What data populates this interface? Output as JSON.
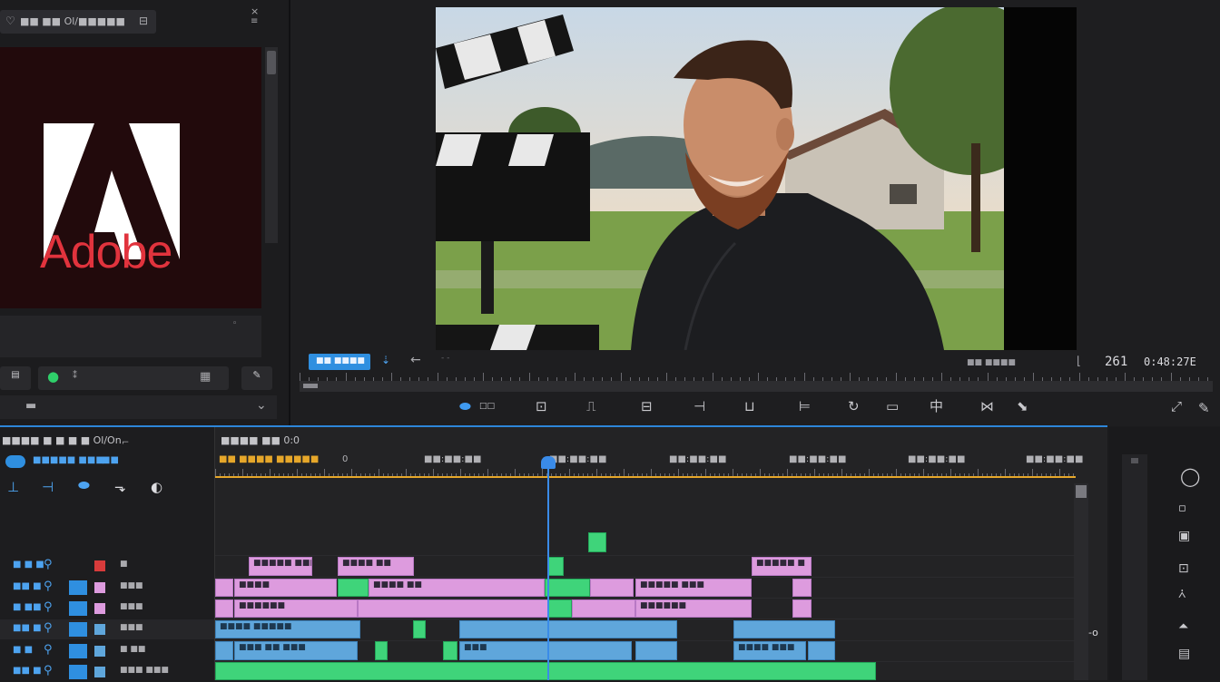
{
  "project": {
    "title": "■■ ■■ Ol/■■■■■"
  },
  "logo": {
    "text": "Adobe"
  },
  "program": {
    "timecode_label": "■■ ■■■■",
    "right_label": "■■ ■■■■",
    "frame_number": "261",
    "timecode": "0:48:27E"
  },
  "transport_icons": [
    "captions-icon",
    "safe-margins-icon",
    "mark-in-icon",
    "mark-out-icon",
    "add-marker-icon",
    "step-back-icon",
    "play-icon",
    "step-forward-icon",
    "go-to-out-icon",
    "insert-icon",
    "overwrite-icon",
    "export-frame-icon",
    "settings-icon"
  ],
  "timeline": {
    "header_title": "■■■■ ■ ■ ■ ■ Ol/On",
    "sequence_title": "■■■■ ■■ 0:0",
    "left_sub": "■■■■■ ■■■",
    "timecodes": [
      "■■ ■■■■ ■■■■■",
      "0",
      "■■:■■:■■",
      "■■:■■:■■",
      "■■:■■:■■",
      "■■:■■:■■",
      "■■:■■:■■",
      "■■:■■:■■"
    ],
    "tracks": [
      {
        "label": "■ ■ ■",
        "tag": "■"
      },
      {
        "label": "■■ ■",
        "tag": "■■■"
      },
      {
        "label": "■ ■■",
        "tag": "■■■"
      },
      {
        "label": "■■ ■",
        "tag": "■■■"
      },
      {
        "label": "■ ■",
        "tag": "■ ■■"
      },
      {
        "label": "■■ ■",
        "tag": "■■■ ■■■"
      }
    ],
    "clip_labels": {
      "p1": "■■■■■ ■■■",
      "p2": "■■■■ ■■",
      "p3": "■■■■",
      "p4": "■■■■ ■■",
      "p5": "■■■■■ ■■■",
      "p6": "■■■■■■",
      "p7": "■■■■■■",
      "p8": "■■■■■ ■",
      "b1": "■■■■ ■■■■■",
      "b2": "■■■ ■■ ■■■",
      "b3": "■■■",
      "b4": "■■■■ ■■■"
    }
  },
  "colors": {
    "accent_blue": "#2f8fe0",
    "playhead": "#3a8be8",
    "audio_pink": "#dd9bde",
    "video_blue": "#5fa6db",
    "audio_green": "#3fd47a",
    "logo_red": "#e1333d"
  }
}
